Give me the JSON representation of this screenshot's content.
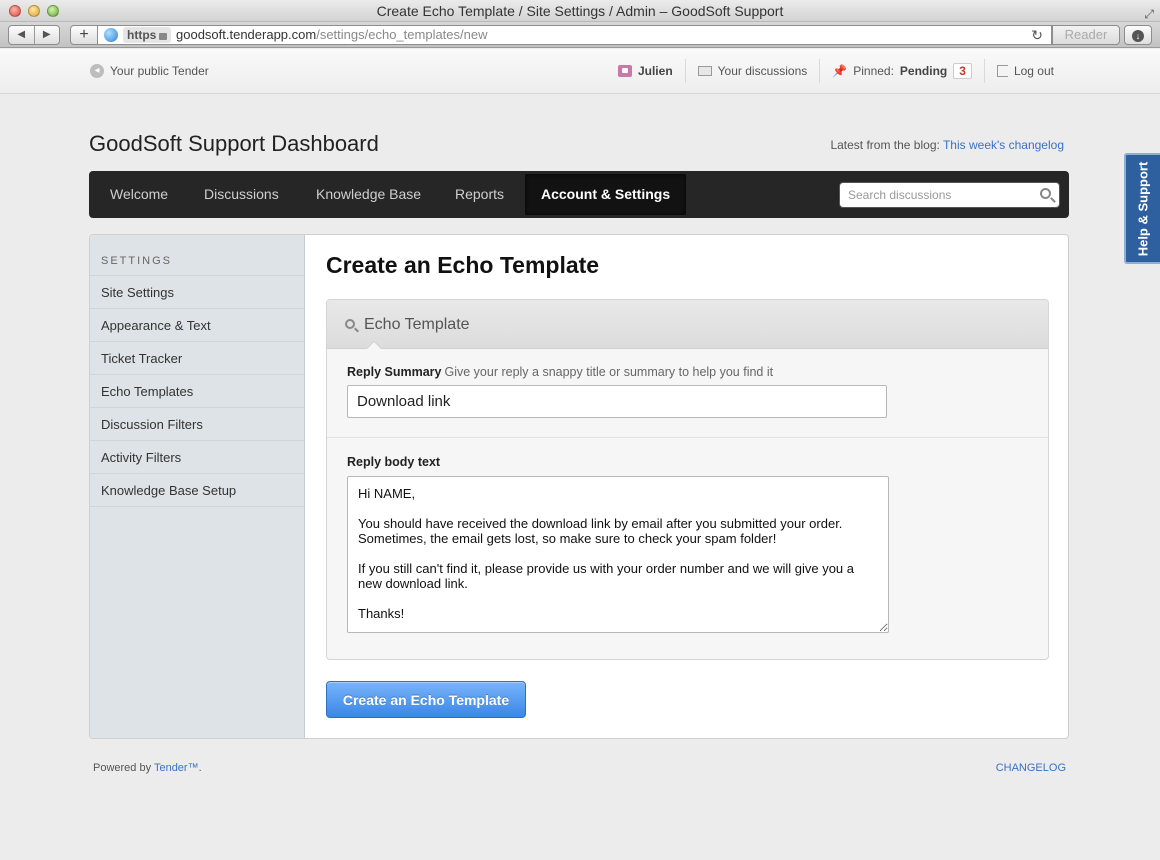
{
  "window": {
    "title": "Create Echo Template / Site Settings / Admin – GoodSoft Support"
  },
  "browser": {
    "scheme_badge": "https",
    "url_host": "goodsoft.tenderapp.com",
    "url_path": "/settings/echo_templates/new",
    "reader_label": "Reader"
  },
  "userbar": {
    "public_link": "Your public Tender",
    "username": "Julien",
    "discussions": "Your discussions",
    "pinned_prefix": "Pinned:",
    "pinned_state": "Pending",
    "pinned_count": "3",
    "logout": "Log out"
  },
  "header": {
    "title": "GoodSoft Support Dashboard",
    "blog_prefix": "Latest from the blog:",
    "blog_link": "This week's changelog"
  },
  "nav": {
    "tabs": [
      {
        "label": "Welcome"
      },
      {
        "label": "Discussions"
      },
      {
        "label": "Knowledge Base"
      },
      {
        "label": "Reports"
      },
      {
        "label": "Account & Settings",
        "active": true
      }
    ],
    "search_placeholder": "Search discussions"
  },
  "sidebar": {
    "heading": "SETTINGS",
    "items": [
      {
        "label": "Site Settings"
      },
      {
        "label": "Appearance & Text"
      },
      {
        "label": "Ticket Tracker"
      },
      {
        "label": "Echo Templates"
      },
      {
        "label": "Discussion Filters"
      },
      {
        "label": "Activity Filters"
      },
      {
        "label": "Knowledge Base Setup"
      }
    ]
  },
  "main": {
    "heading": "Create an Echo Template",
    "form_legend": "Echo Template",
    "summary_label": "Reply Summary",
    "summary_hint": "Give your reply a snappy title or summary to help you find it",
    "summary_value": "Download link",
    "body_label": "Reply body text",
    "body_value": "Hi NAME,\n\nYou should have received the download link by email after you submitted your order. Sometimes, the email gets lost, so make sure to check your spam folder!\n\nIf you still can't find it, please provide us with your order number and we will give you a new download link.\n\nThanks!",
    "submit_label": "Create an Echo Template"
  },
  "footer": {
    "powered_prefix": "Powered by",
    "powered_link": "Tender™",
    "powered_suffix": ".",
    "changelog": "CHANGELOG"
  },
  "help_tab": {
    "label": "Help & Support"
  },
  "colors": {
    "accent": "#3a87e6",
    "link": "#3a72c4",
    "nav_bg": "#262626",
    "sidebar_bg": "#dde3e6"
  }
}
